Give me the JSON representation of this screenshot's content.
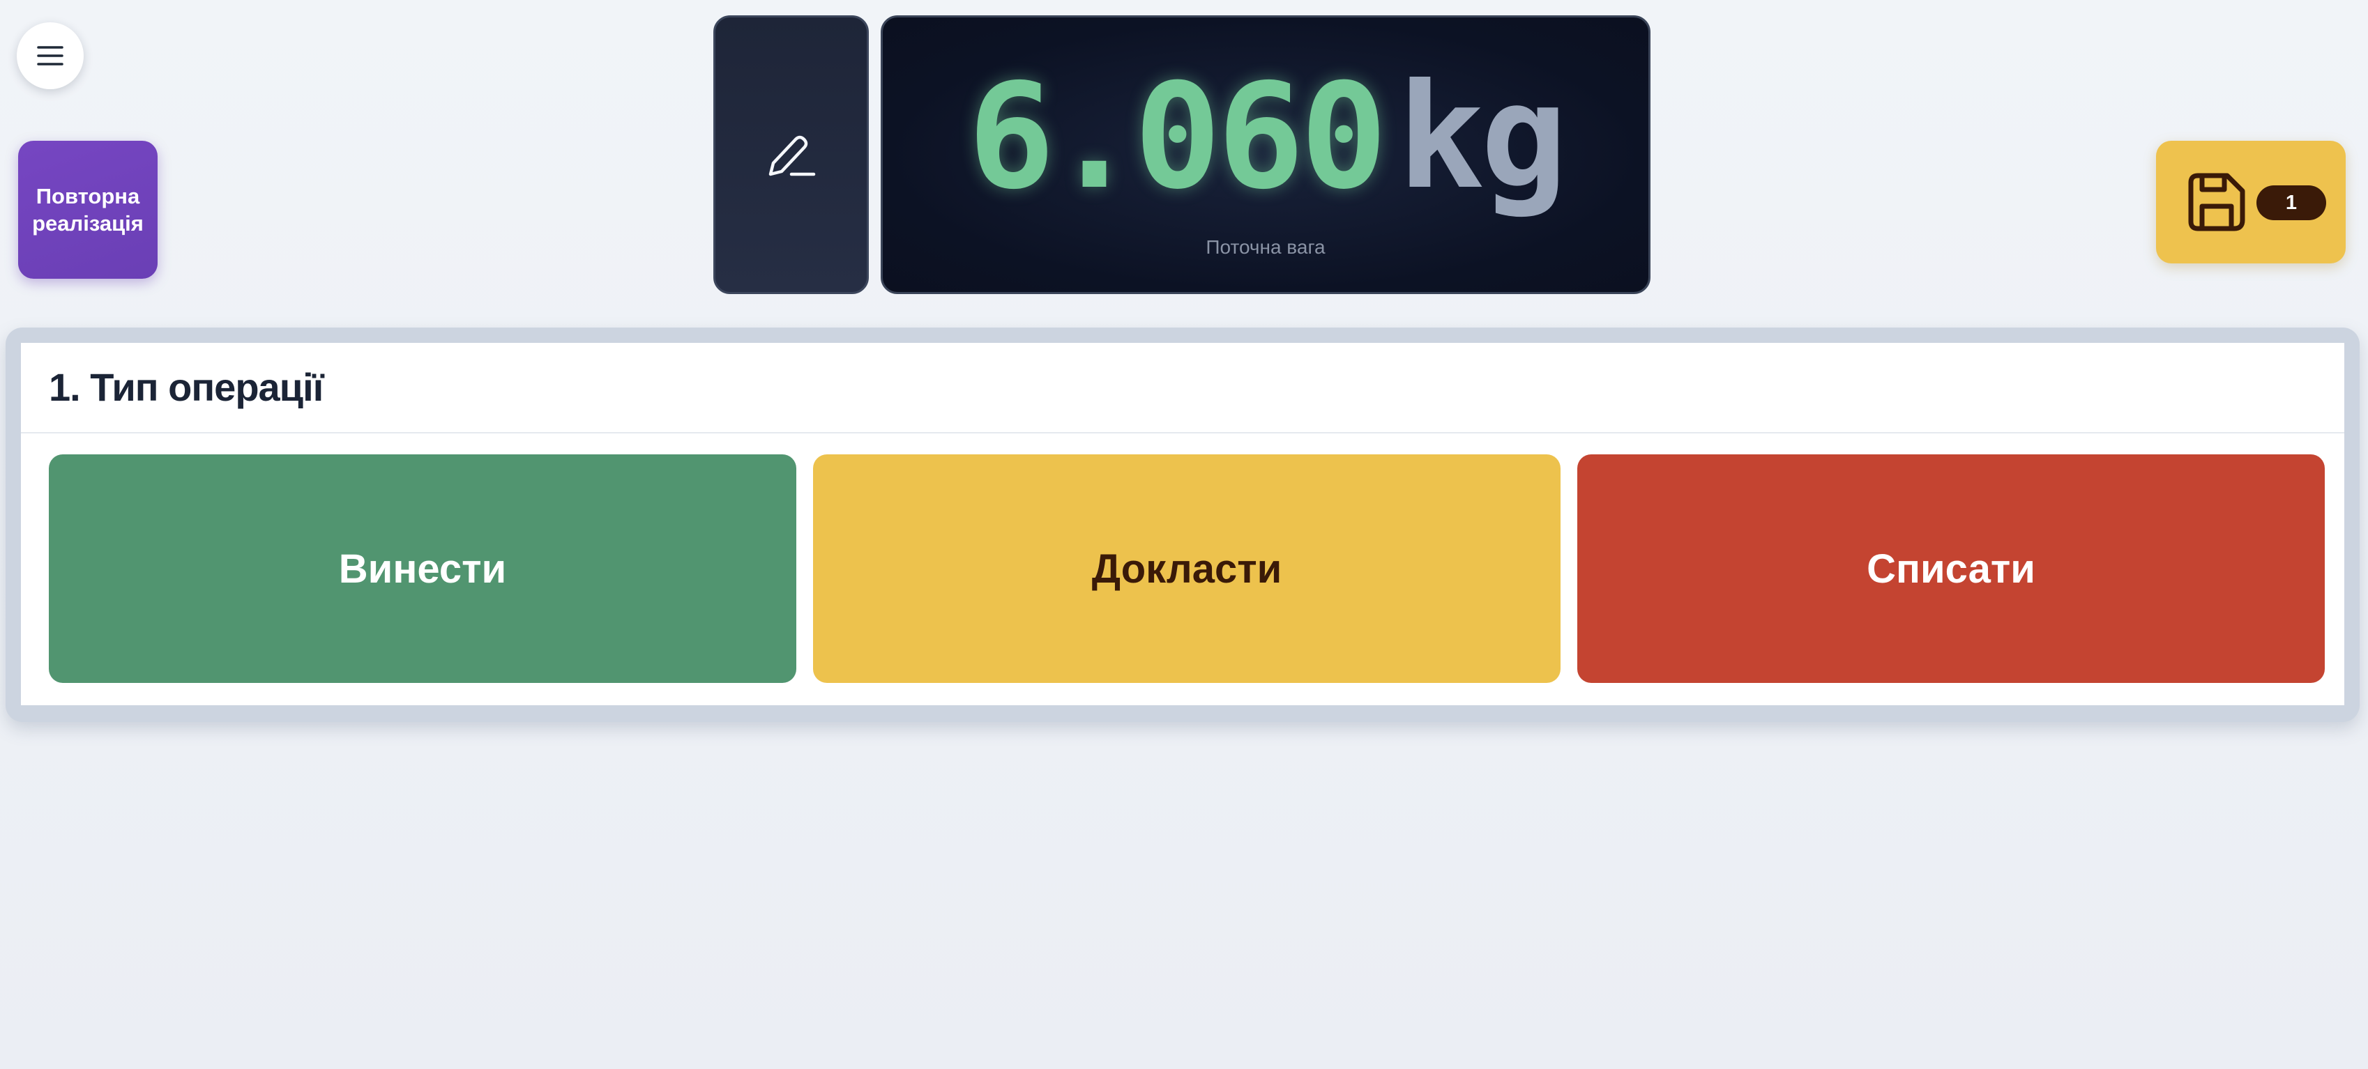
{
  "header": {
    "menu_icon": "menu-icon",
    "resale_button_label": "Повторна реалізація",
    "edit_icon": "pencil-icon"
  },
  "scale": {
    "weight_value": "6.060",
    "weight_unit": "kg",
    "caption": "Поточна вага"
  },
  "save": {
    "icon": "save-icon",
    "badge_count": "1"
  },
  "operation": {
    "title": "1. Тип операції",
    "buttons": [
      {
        "label": "Винести",
        "color": "#519570"
      },
      {
        "label": "Докласти",
        "color": "#edc24d"
      },
      {
        "label": "Списати",
        "color": "#c44431"
      }
    ]
  },
  "colors": {
    "accent_purple": "#6a3fb5",
    "weight_green": "#74c997",
    "save_yellow": "#eec24e"
  }
}
